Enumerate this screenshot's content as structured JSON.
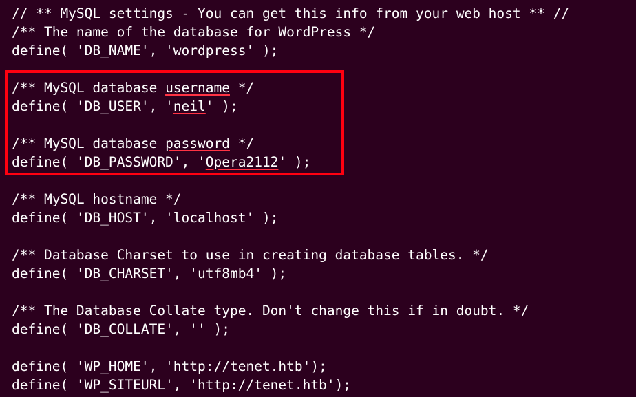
{
  "lines": {
    "l1": "// ** MySQL settings - You can get this info from your web host ** //",
    "l2": "/** The name of the database for WordPress */",
    "l3": "define( 'DB_NAME', 'wordpress' );",
    "l4": "",
    "l5a": "/** MySQL database ",
    "l5u": "username",
    "l5b": " */",
    "l6a": "define( 'DB_USER', '",
    "l6u": "neil",
    "l6b": "' );",
    "l7": "",
    "l8a": "/** MySQL database ",
    "l8u": "password",
    "l8b": " */",
    "l9a": "define( 'DB_PASSWORD', '",
    "l9u": "Opera2112",
    "l9b": "' );",
    "l10": "",
    "l11": "/** MySQL hostname */",
    "l12": "define( 'DB_HOST', 'localhost' );",
    "l13": "",
    "l14": "/** Database Charset to use in creating database tables. */",
    "l15": "define( 'DB_CHARSET', 'utf8mb4' );",
    "l16": "",
    "l17": "/** The Database Collate type. Don't change this if in doubt. */",
    "l18": "define( 'DB_COLLATE', '' );",
    "l19": "",
    "l20": "define( 'WP_HOME', 'http://tenet.htb');",
    "l21": "define( 'WP_SITEURL', 'http://tenet.htb');"
  }
}
